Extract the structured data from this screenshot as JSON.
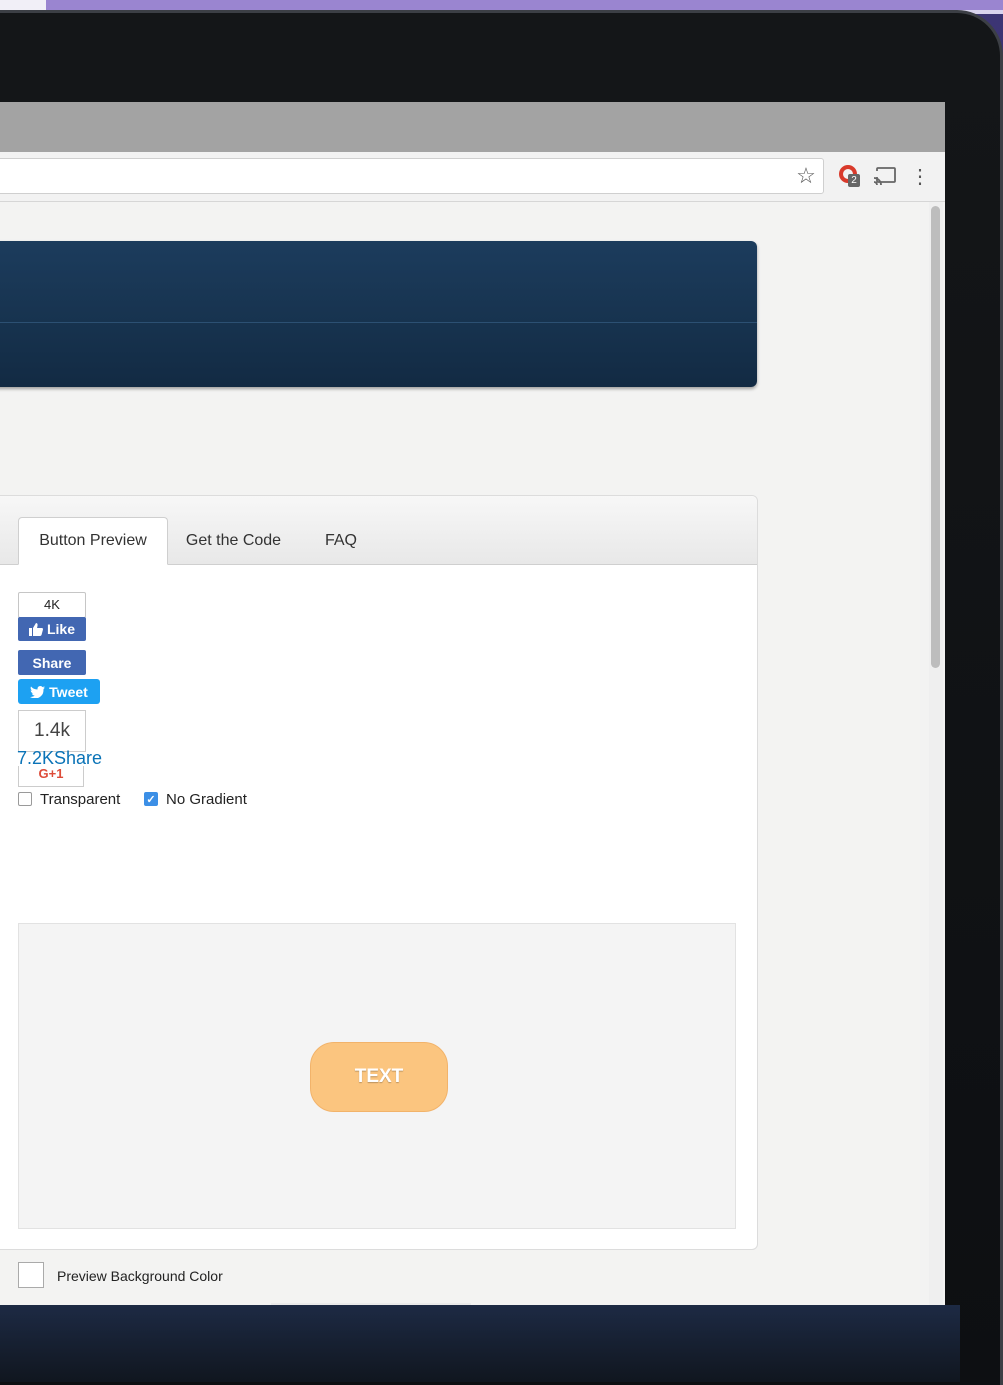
{
  "browser": {
    "extension_badge": "2"
  },
  "tabs": [
    {
      "label": "Button Preview",
      "active": true
    },
    {
      "label": "Get the Code",
      "active": false
    },
    {
      "label": "FAQ",
      "active": false
    }
  ],
  "social": {
    "fb_like_count": "4K",
    "fb_like_label": "Like",
    "fb_share_label": "Share",
    "tweet_label": "Tweet",
    "linkedin_count": "1.4k",
    "linkedin_share": "7.2KShare",
    "gplus_label": "G+1"
  },
  "options": {
    "transparent_label": "Transparent",
    "transparent_checked": false,
    "no_gradient_label": "No Gradient",
    "no_gradient_checked": true
  },
  "preview": {
    "button_text": "TEXT",
    "button_color": "#fbc57f"
  },
  "background_color": {
    "label": "Preview Background Color",
    "swatches": [
      "#fbc57f",
      "#f7931e",
      "#ffffff",
      "#f0b44c",
      "#fde3c4",
      "#d4a04f"
    ]
  }
}
